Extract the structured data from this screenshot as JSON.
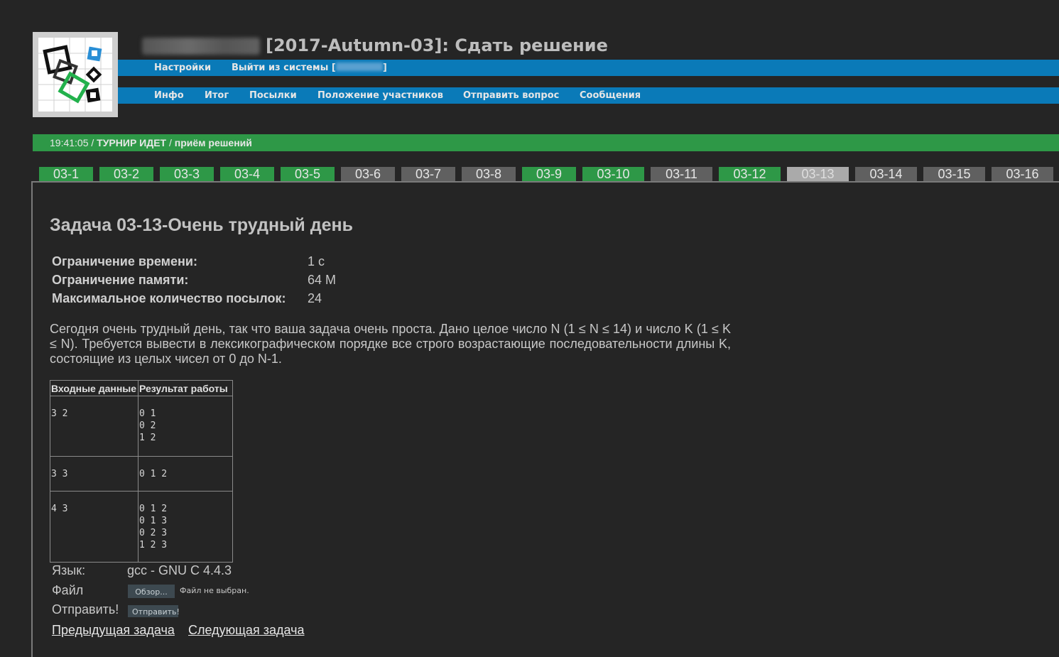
{
  "header": {
    "title": "[2017-Autumn-03]: Сдать решение"
  },
  "top_nav": {
    "settings": "Настройки",
    "logout": "Выйти из системы [",
    "logout_close": "]"
  },
  "main_nav": {
    "info": "Инфо",
    "summary": "Итог",
    "submissions": "Посылки",
    "standings": "Положение участников",
    "ask_question": "Отправить вопрос",
    "messages": "Сообщения"
  },
  "status": {
    "time": "19:41:05",
    "sep1": " / ",
    "state": "ТУРНИР ИДЕТ",
    "sep2": " / ",
    "mode": "приём решений"
  },
  "tabs": [
    {
      "label": "03-1",
      "state": "ok"
    },
    {
      "label": "03-2",
      "state": "ok"
    },
    {
      "label": "03-3",
      "state": "ok"
    },
    {
      "label": "03-4",
      "state": "ok"
    },
    {
      "label": "03-5",
      "state": "ok"
    },
    {
      "label": "03-6",
      "state": "none"
    },
    {
      "label": "03-7",
      "state": "none"
    },
    {
      "label": "03-8",
      "state": "none"
    },
    {
      "label": "03-9",
      "state": "ok"
    },
    {
      "label": "03-10",
      "state": "ok"
    },
    {
      "label": "03-11",
      "state": "none"
    },
    {
      "label": "03-12",
      "state": "ok"
    },
    {
      "label": "03-13",
      "state": "active"
    },
    {
      "label": "03-14",
      "state": "none"
    },
    {
      "label": "03-15",
      "state": "none"
    },
    {
      "label": "03-16",
      "state": "none"
    }
  ],
  "problem": {
    "title": "Задача 03-13-Очень трудный день",
    "limits": {
      "time_label": "Ограничение времени:",
      "time_value": "1 с",
      "memory_label": "Ограничение памяти:",
      "memory_value": "64 М",
      "submits_label": "Максимальное количество посылок:",
      "submits_value": "24"
    },
    "statement": "Сегодня очень трудный день, так что ваша задача очень проста. Дано целое число N (1 ≤ N ≤ 14) и число K (1 ≤ K ≤ N). Требуется вывести в лексикографическом порядке все строго возрастающие последовательности длины K, состоящие из целых чисел от 0 до N-1.",
    "samples": {
      "input_header": "Входные данные",
      "output_header": "Результат работы",
      "rows": [
        {
          "input": "3 2",
          "output": "0 1\n0 2\n1 2"
        },
        {
          "input": "3 3",
          "output": "0 1 2"
        },
        {
          "input": "4 3",
          "output": "0 1 2\n0 1 3\n0 2 3\n1 2 3"
        }
      ]
    }
  },
  "form": {
    "language_label": "Язык:",
    "language_value": "gcc - GNU C 4.4.3",
    "file_label": "Файл",
    "browse_button": "Обзор...",
    "file_status": "Файл не выбран.",
    "submit_label": "Отправить!",
    "submit_button": "Отправить!"
  },
  "links": {
    "prev": "Предыдущая задача",
    "next": "Следующая задача"
  },
  "colors": {
    "navbar": "#0a7ab8",
    "status_ok": "#2e9847",
    "tab_none": "#606060",
    "tab_active": "#aaaaaa",
    "background": "#252525"
  }
}
